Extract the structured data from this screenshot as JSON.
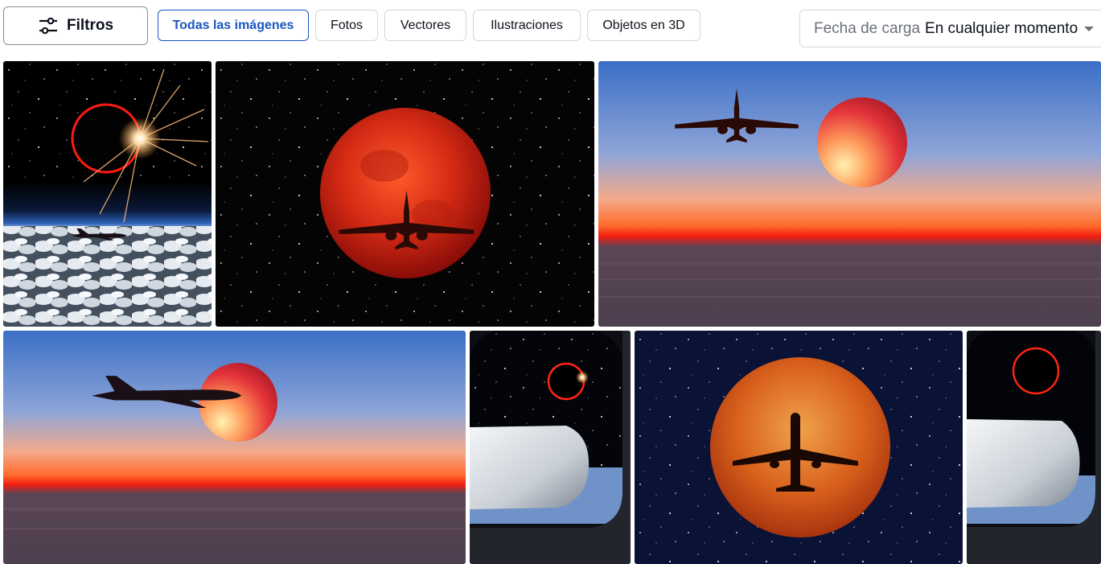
{
  "toolbar": {
    "filters_label": "Filtros",
    "chips": [
      {
        "label": "Todas las imágenes",
        "active": true
      },
      {
        "label": "Fotos",
        "active": false
      },
      {
        "label": "Vectores",
        "active": false
      },
      {
        "label": "Ilustraciones",
        "active": false
      },
      {
        "label": "Objetos en 3D",
        "active": false
      }
    ],
    "date_filter": {
      "label": "Fecha de carga",
      "value": "En cualquier momento"
    }
  },
  "colors": {
    "accent": "#1857c1",
    "moon_red": "#c8221a",
    "sky_blue": "#3f76c9",
    "horizon_orange": "#ff4a14"
  }
}
